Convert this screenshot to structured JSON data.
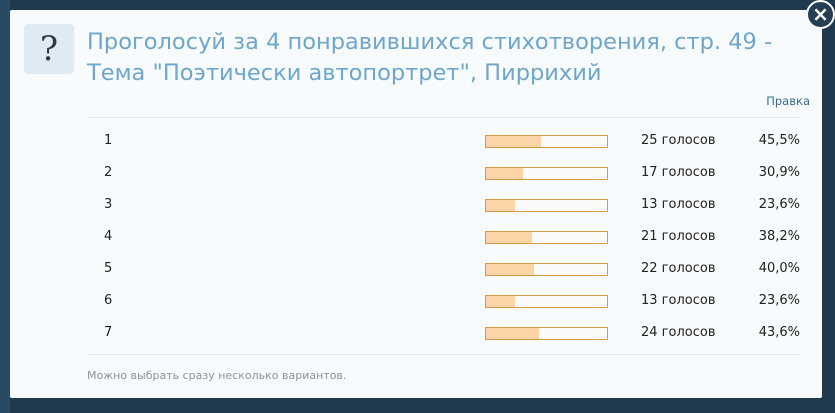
{
  "dialog": {
    "icon": "?",
    "title_line1": "Проголосуй за 4 понравившихся стихотворения, стр. 49 -",
    "title_line2": "Тема \"Поэтически автопортрет\", Пиррихий",
    "edit_label": "Правка",
    "note": "Можно выбрать сразу несколько вариантов.",
    "close_icon": "close-icon"
  },
  "poll": {
    "rows": [
      {
        "label": "1",
        "votes": "25 голосов",
        "percent": "45,5%",
        "fraction": 0.455
      },
      {
        "label": "2",
        "votes": "17 голосов",
        "percent": "30,9%",
        "fraction": 0.309
      },
      {
        "label": "3",
        "votes": "13 голосов",
        "percent": "23,6%",
        "fraction": 0.236
      },
      {
        "label": "4",
        "votes": "21 голосов",
        "percent": "38,2%",
        "fraction": 0.382
      },
      {
        "label": "5",
        "votes": "22 голосов",
        "percent": "40,0%",
        "fraction": 0.4
      },
      {
        "label": "6",
        "votes": "13 голосов",
        "percent": "23,6%",
        "fraction": 0.236
      },
      {
        "label": "7",
        "votes": "24 голосов",
        "percent": "43,6%",
        "fraction": 0.436
      }
    ]
  },
  "colors": {
    "title": "#6ea6cc",
    "bar_fill": "#fbd5a8",
    "bar_border": "#d79a47"
  }
}
